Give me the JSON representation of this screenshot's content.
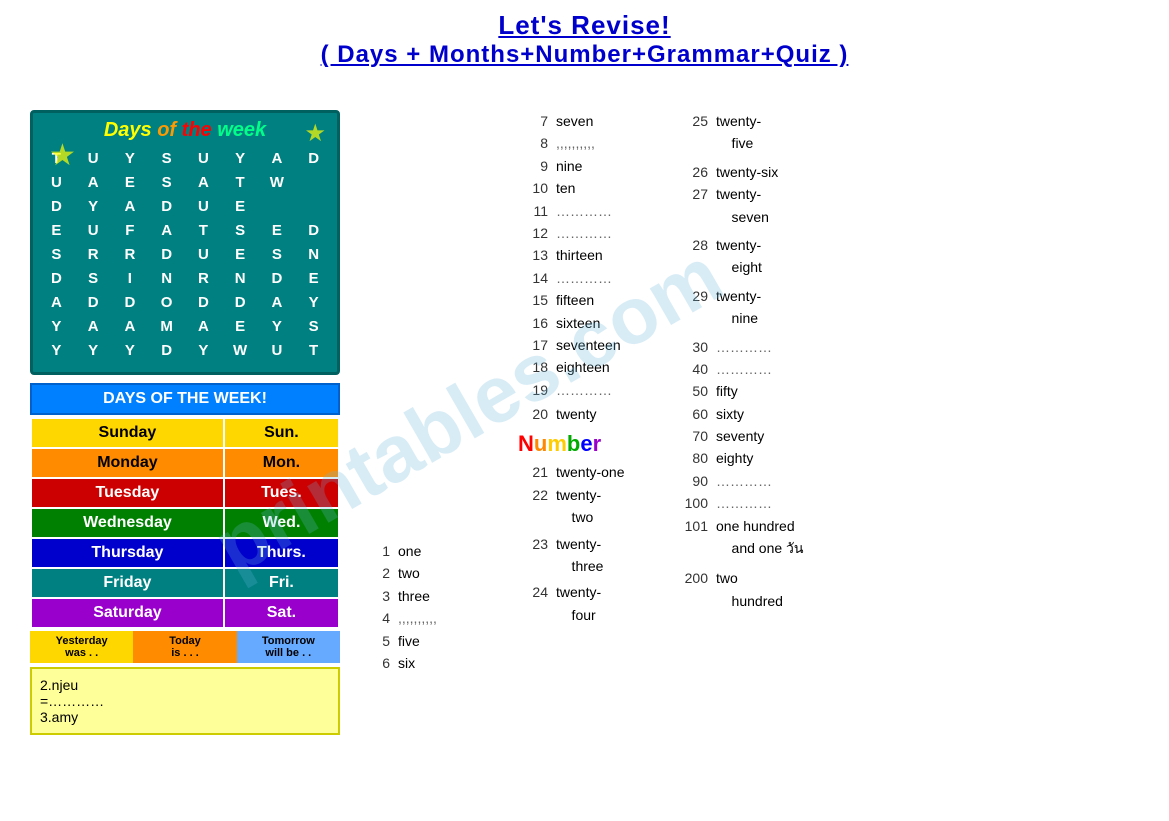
{
  "title": {
    "line1": "Let's Revise!",
    "line2": "( Days + Months+Number+Grammar+Quiz )"
  },
  "wordsearch": {
    "header": "Days of the week",
    "grid": [
      "T",
      "U",
      "Y",
      "S",
      "U",
      "Y",
      "A",
      "D",
      "U",
      "A",
      "E",
      "S",
      "A",
      "T",
      "W",
      "",
      "D",
      "Y",
      "A",
      "D",
      "U",
      "E",
      "",
      "",
      "E",
      "U",
      "F",
      "A",
      "T",
      "S",
      "E",
      "D",
      "S",
      "R",
      "R",
      "D",
      "U",
      "E",
      "S",
      "N",
      "D",
      "S",
      "I",
      "N",
      "R",
      "N",
      "D",
      "E",
      "A",
      "D",
      "D",
      "O",
      "D",
      "D",
      "A",
      "Y",
      "Y",
      "A",
      "A",
      "M",
      "A",
      "E",
      "Y",
      "S",
      "Y",
      "Y",
      "Y",
      "D",
      "Y",
      "W",
      "U",
      "T"
    ],
    "grid_full": [
      [
        "T",
        "U",
        "Y",
        "S",
        "U",
        "Y",
        "A",
        "D"
      ],
      [
        "U",
        "A",
        "E",
        "S",
        "A",
        "T",
        "W",
        ""
      ],
      [
        "D",
        "Y",
        "A",
        "D",
        "U",
        "E",
        "",
        ""
      ],
      [
        "E",
        "U",
        "F",
        "A",
        "T",
        "S",
        "E",
        "D"
      ],
      [
        "S",
        "R",
        "R",
        "D",
        "U",
        "E",
        "S",
        "N"
      ],
      [
        "D",
        "S",
        "I",
        "N",
        "R",
        "N",
        "D",
        "E"
      ],
      [
        "A",
        "D",
        "D",
        "O",
        "D",
        "D",
        "A",
        "Y"
      ],
      [
        "Y",
        "A",
        "A",
        "M",
        "A",
        "E",
        "Y",
        "S"
      ],
      [
        "Y",
        "Y",
        "Y",
        "D",
        "Y",
        "W",
        "U",
        "T"
      ]
    ]
  },
  "days_of_week": {
    "header": "DAYS OF THE WEEK!",
    "days": [
      {
        "name": "Sunday",
        "abbr": "Sun."
      },
      {
        "name": "Monday",
        "abbr": "Mon."
      },
      {
        "name": "Tuesday",
        "abbr": "Tues."
      },
      {
        "name": "Wednesday",
        "abbr": "Wed."
      },
      {
        "name": "Thursday",
        "abbr": "Thurs."
      },
      {
        "name": "Friday",
        "abbr": "Fri."
      },
      {
        "name": "Saturday",
        "abbr": "Sat."
      }
    ],
    "yesterday_label": "Yesterday was . .",
    "today_label": "Today is . . .",
    "tomorrow_label": "Tomorrow will be . ."
  },
  "exercise": {
    "line1": "2.njeu",
    "line2": "=…………",
    "line3": "3.amy"
  },
  "numbers_col1": [
    {
      "num": "1",
      "word": "one"
    },
    {
      "num": "2",
      "word": "two"
    },
    {
      "num": "3",
      "word": "three"
    },
    {
      "num": "4",
      "word": ",,,,,,,,,,"
    },
    {
      "num": "5",
      "word": "five"
    },
    {
      "num": "6",
      "word": "six"
    }
  ],
  "numbers_col2": [
    {
      "num": "7",
      "word": "seven"
    },
    {
      "num": "8",
      "word": ",,,,,,,,,,"
    },
    {
      "num": "9",
      "word": "nine"
    },
    {
      "num": "10",
      "word": "ten"
    },
    {
      "num": "11",
      "word": "…………"
    },
    {
      "num": "12",
      "word": "…………"
    },
    {
      "num": "13",
      "word": "thirteen"
    },
    {
      "num": "14",
      "word": "…………"
    },
    {
      "num": "15",
      "word": "fifteen"
    },
    {
      "num": "16",
      "word": "sixteen"
    },
    {
      "num": "17",
      "word": "seventeen"
    },
    {
      "num": "18",
      "word": "eighteen"
    },
    {
      "num": "19",
      "word": "…………"
    },
    {
      "num": "20",
      "word": "twenty"
    }
  ],
  "number_section_header": "Number",
  "numbers_col3": [
    {
      "num": "21",
      "word": "twenty-one"
    },
    {
      "num": "22",
      "word": "twenty-two"
    },
    {
      "num": "23",
      "word": "twenty-three"
    },
    {
      "num": "24",
      "word": "twenty-four"
    }
  ],
  "numbers_col4": [
    {
      "num": "25",
      "word": "twenty-five"
    },
    {
      "num": "26",
      "word": "twenty-six"
    },
    {
      "num": "27",
      "word": "twenty-seven"
    },
    {
      "num": "28",
      "word": "twenty-eight"
    },
    {
      "num": "29",
      "word": "twenty-nine"
    },
    {
      "num": "30",
      "word": "…………"
    },
    {
      "num": "40",
      "word": "…………"
    },
    {
      "num": "50",
      "word": "fifty"
    },
    {
      "num": "60",
      "word": "sixty"
    },
    {
      "num": "70",
      "word": "seventy"
    },
    {
      "num": "80",
      "word": "eighty"
    },
    {
      "num": "90",
      "word": "…………"
    },
    {
      "num": "100",
      "word": "…………"
    },
    {
      "num": "101",
      "word": "one hundred and one วัน"
    },
    {
      "num": "200",
      "word": "two hundred"
    }
  ],
  "watermark": "printables.com"
}
